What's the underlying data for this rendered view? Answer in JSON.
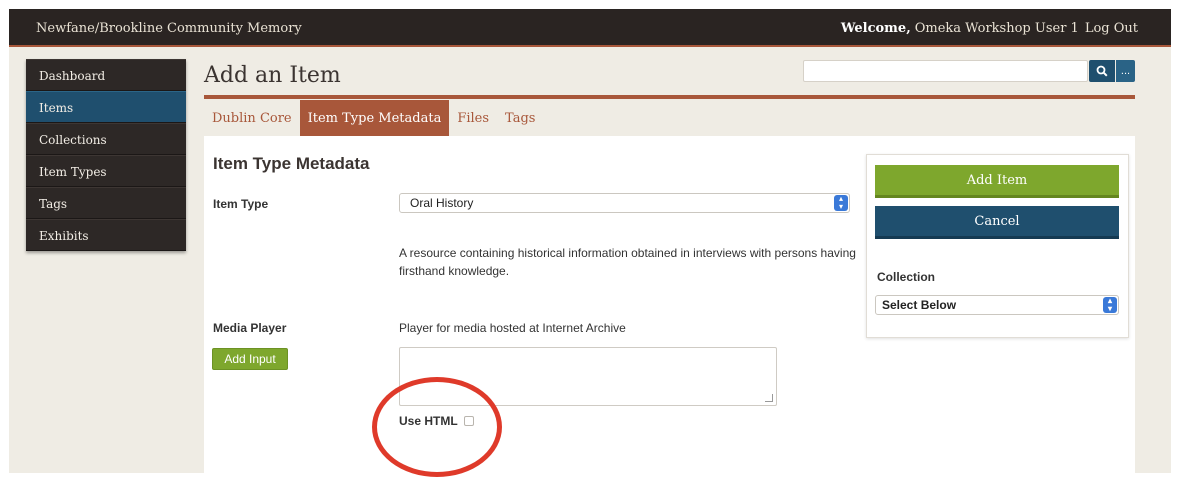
{
  "topbar": {
    "site_title": "Newfane/Brookline Community Memory",
    "welcome_label": "Welcome,",
    "username": "Omeka Workshop User 1",
    "logout": "Log Out"
  },
  "sidebar": {
    "items": [
      {
        "label": "Dashboard"
      },
      {
        "label": "Items"
      },
      {
        "label": "Collections"
      },
      {
        "label": "Item Types"
      },
      {
        "label": "Tags"
      },
      {
        "label": "Exhibits"
      }
    ],
    "active": "Items"
  },
  "header": {
    "title": "Add an Item",
    "search": {
      "value": "",
      "placeholder": ""
    },
    "more_label": "..."
  },
  "tabs": [
    {
      "label": "Dublin Core"
    },
    {
      "label": "Item Type Metadata"
    },
    {
      "label": "Files"
    },
    {
      "label": "Tags"
    }
  ],
  "main": {
    "section_heading": "Item Type Metadata",
    "item_type_label": "Item Type",
    "item_type_value": "Oral History",
    "item_type_description": "A resource containing historical information obtained in interviews with persons having firsthand knowledge.",
    "media_player_label": "Media Player",
    "add_input_label": "Add Input",
    "media_description": "Player for media hosted at Internet Archive",
    "media_value": "",
    "use_html_label": "Use HTML",
    "use_html_checked": false
  },
  "side_panel": {
    "add_item_label": "Add Item",
    "cancel_label": "Cancel",
    "collection_label": "Collection",
    "collection_value": "Select Below"
  },
  "colors": {
    "accent": "#a8573a",
    "nav_active": "#1f4f6e",
    "primary_button": "#7ea72d",
    "annotation": "#df3a2a"
  },
  "icons": {
    "search": "search-icon",
    "select_arrows": "select-arrows-icon",
    "resize": "resize-handle-icon"
  }
}
